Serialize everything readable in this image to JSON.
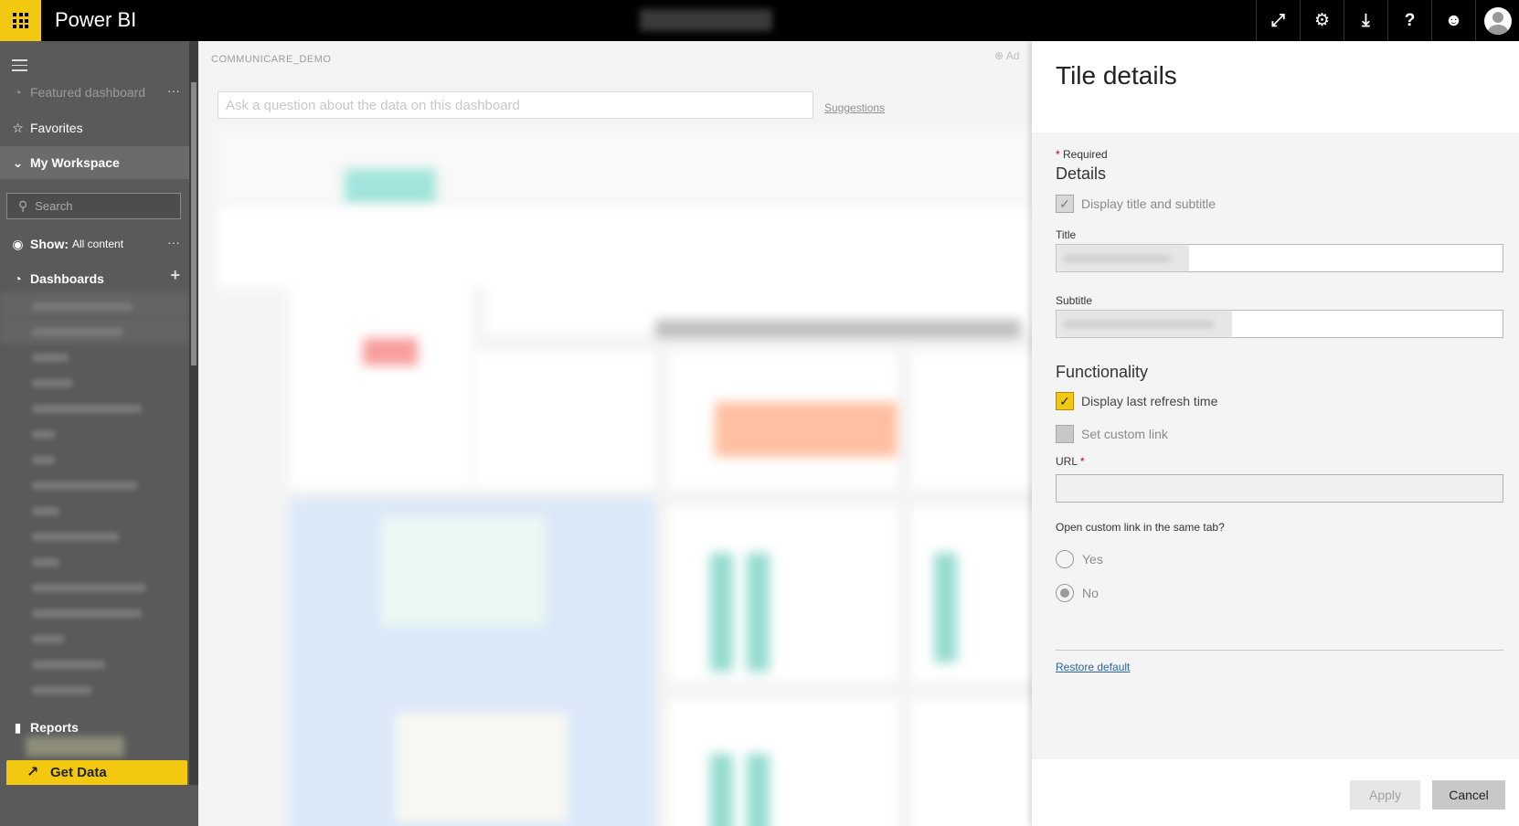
{
  "app": {
    "brand": "Power BI"
  },
  "topbar": {
    "icons": [
      "fullscreen-icon",
      "gear-icon",
      "download-icon",
      "help-icon",
      "smiley-icon",
      "avatar"
    ]
  },
  "nav": {
    "featured": "Featured dashboard",
    "favorites": "Favorites",
    "workspace": "My Workspace",
    "search_placeholder": "Search",
    "show_label": "Show:",
    "show_value": "All content",
    "dashboards": "Dashboards",
    "reports": "Reports",
    "get_data": "Get Data",
    "more": "···",
    "add": "+"
  },
  "main": {
    "breadcrumb": "COMMUNICARE_DEMO",
    "add_tile": "Ad",
    "qa_placeholder": "Ask a question about the data on this dashboard",
    "suggestions": "Suggestions"
  },
  "panel": {
    "title": "Tile details",
    "required": "Required",
    "details_heading": "Details",
    "display_title_subtitle": "Display title and subtitle",
    "title_label": "Title",
    "subtitle_label": "Subtitle",
    "functionality_heading": "Functionality",
    "display_refresh": "Display last refresh time",
    "set_custom_link": "Set custom link",
    "url_label": "URL",
    "same_tab_question": "Open custom link in the same tab?",
    "yes": "Yes",
    "no": "No",
    "restore_default": "Restore default",
    "apply": "Apply",
    "cancel": "Cancel",
    "state": {
      "display_title_subtitle": true,
      "display_refresh": true,
      "set_custom_link": false,
      "same_tab": "No"
    }
  },
  "colors": {
    "accent": "#f2c811",
    "nav_bg": "#5a5a5a",
    "topbar": "#000000",
    "link": "#2765a6"
  }
}
